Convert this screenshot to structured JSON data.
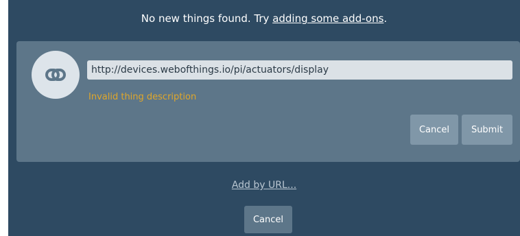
{
  "notice": {
    "prefix": "No new things found. Try ",
    "link": "adding some add-ons",
    "suffix": "."
  },
  "card": {
    "icon": "link-icon",
    "url_value": "http://devices.webofthings.io/pi/actuators/display",
    "error": "Invalid thing description",
    "cancel_label": "Cancel",
    "submit_label": "Submit"
  },
  "add_by_url_label": "Add by URL...",
  "cancel_label": "Cancel",
  "colors": {
    "background": "#2e4a62",
    "card": "#5d7689",
    "error": "#e0a72a",
    "button": "#8097a8"
  }
}
